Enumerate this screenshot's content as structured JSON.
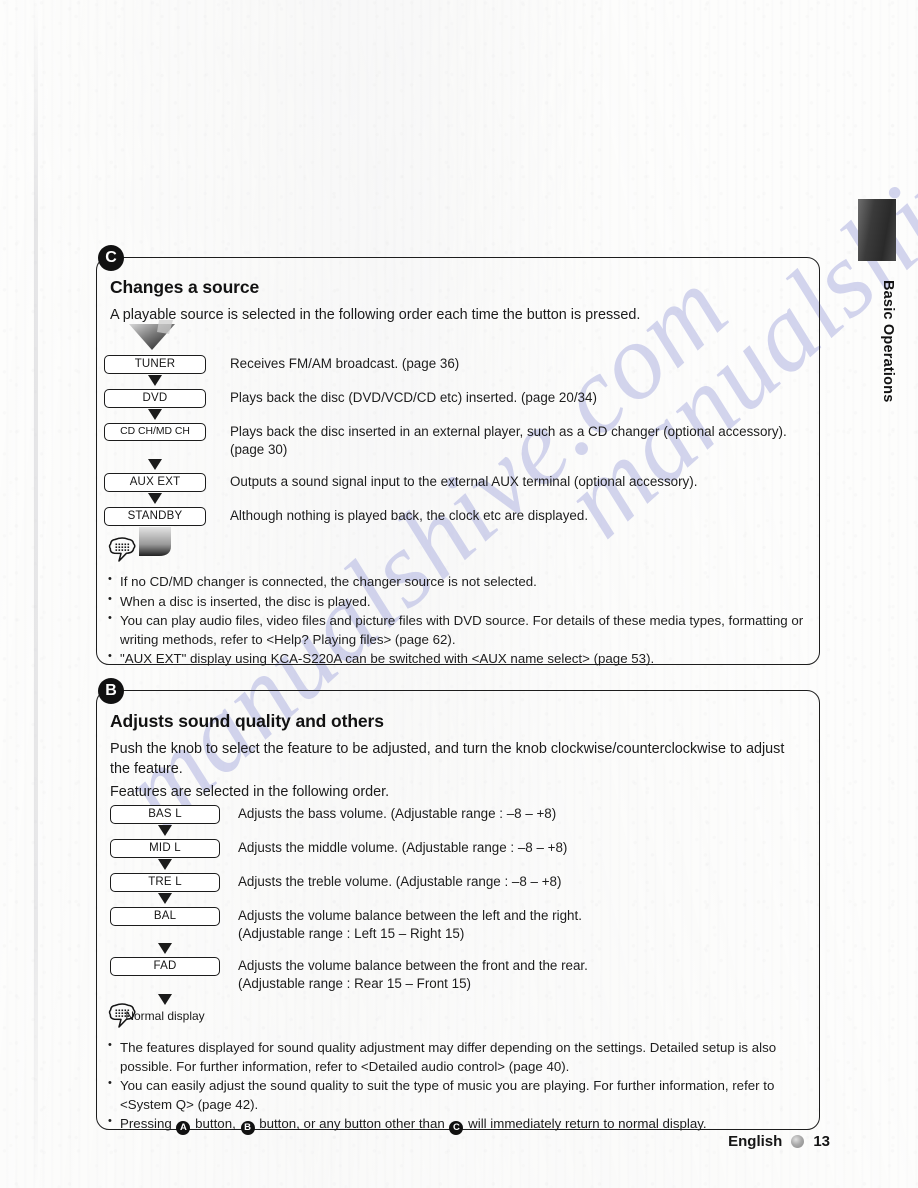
{
  "page": {
    "side_tab_label": "Basic Operations",
    "footer_language": "English",
    "footer_page_number": "13",
    "watermark_text": "manualshive.com",
    "accent_black": "#111111",
    "watermark_color": "#b9bce4"
  },
  "section_c": {
    "badge": "C",
    "title": "Changes a source",
    "lead": "A playable source is selected in the following order each time the button is pressed.",
    "flow": [
      {
        "chip": "TUNER",
        "desc": "Receives FM/AM broadcast. (page 36)"
      },
      {
        "chip": "DVD",
        "desc": "Plays back the disc (DVD/VCD/CD etc) inserted. (page 20/34)"
      },
      {
        "chip": "CD CH/MD CH",
        "desc": "Plays back the disc inserted in an external player, such as a CD changer (optional accessory). (page 30)"
      },
      {
        "chip": "AUX EXT",
        "desc": "Outputs a sound signal input to the external AUX terminal (optional accessory)."
      },
      {
        "chip": "STANDBY",
        "desc": "Although nothing is played back, the clock etc are displayed."
      }
    ],
    "notes": [
      "If no CD/MD changer is connected, the changer source is not selected.",
      "When a disc is inserted, the disc is played.",
      "You can play audio files, video files and picture files with DVD source. For details of these media types, formatting or writing methods, refer to <Help? Playing files> (page 62).",
      "\"AUX EXT\" display using KCA-S220A can be switched with <AUX name select> (page 53)."
    ]
  },
  "section_b": {
    "badge": "B",
    "title": "Adjusts sound quality and others",
    "lead_1": "Push the knob to select the feature to be adjusted, and turn the knob clockwise/counterclockwise to adjust the feature.",
    "lead_2": "Features are selected in the following order.",
    "flow": [
      {
        "chip": "BAS L",
        "desc": "Adjusts the bass volume. (Adjustable range : –8 – +8)"
      },
      {
        "chip": "MID L",
        "desc": "Adjusts the middle volume. (Adjustable range : –8 – +8)"
      },
      {
        "chip": "TRE L",
        "desc": "Adjusts the treble volume. (Adjustable range : –8 – +8)"
      },
      {
        "chip": "BAL",
        "desc": "Adjusts the volume balance between the left and the right.\n(Adjustable range : Left 15 – Right 15)"
      },
      {
        "chip": "FAD",
        "desc": "Adjusts the volume balance between the front and the rear.\n(Adjustable range : Rear 15 – Front 15)"
      }
    ],
    "flow_end_label": "Normal display",
    "notes": [
      "The features displayed for sound quality adjustment may differ depending on the settings. Detailed setup is also possible. For further information, refer to <Detailed audio control> (page 40).",
      "You can easily adjust the sound quality to suit the type of music you are playing. For further information, refer to <System Q> (page 42)."
    ],
    "note_last_parts": {
      "p1": "Pressing ",
      "b1": "A",
      "p2": " button, ",
      "b2": "B",
      "p3": " button, or any button other than ",
      "b3": "C",
      "p4": " will immediately return to normal display."
    }
  }
}
